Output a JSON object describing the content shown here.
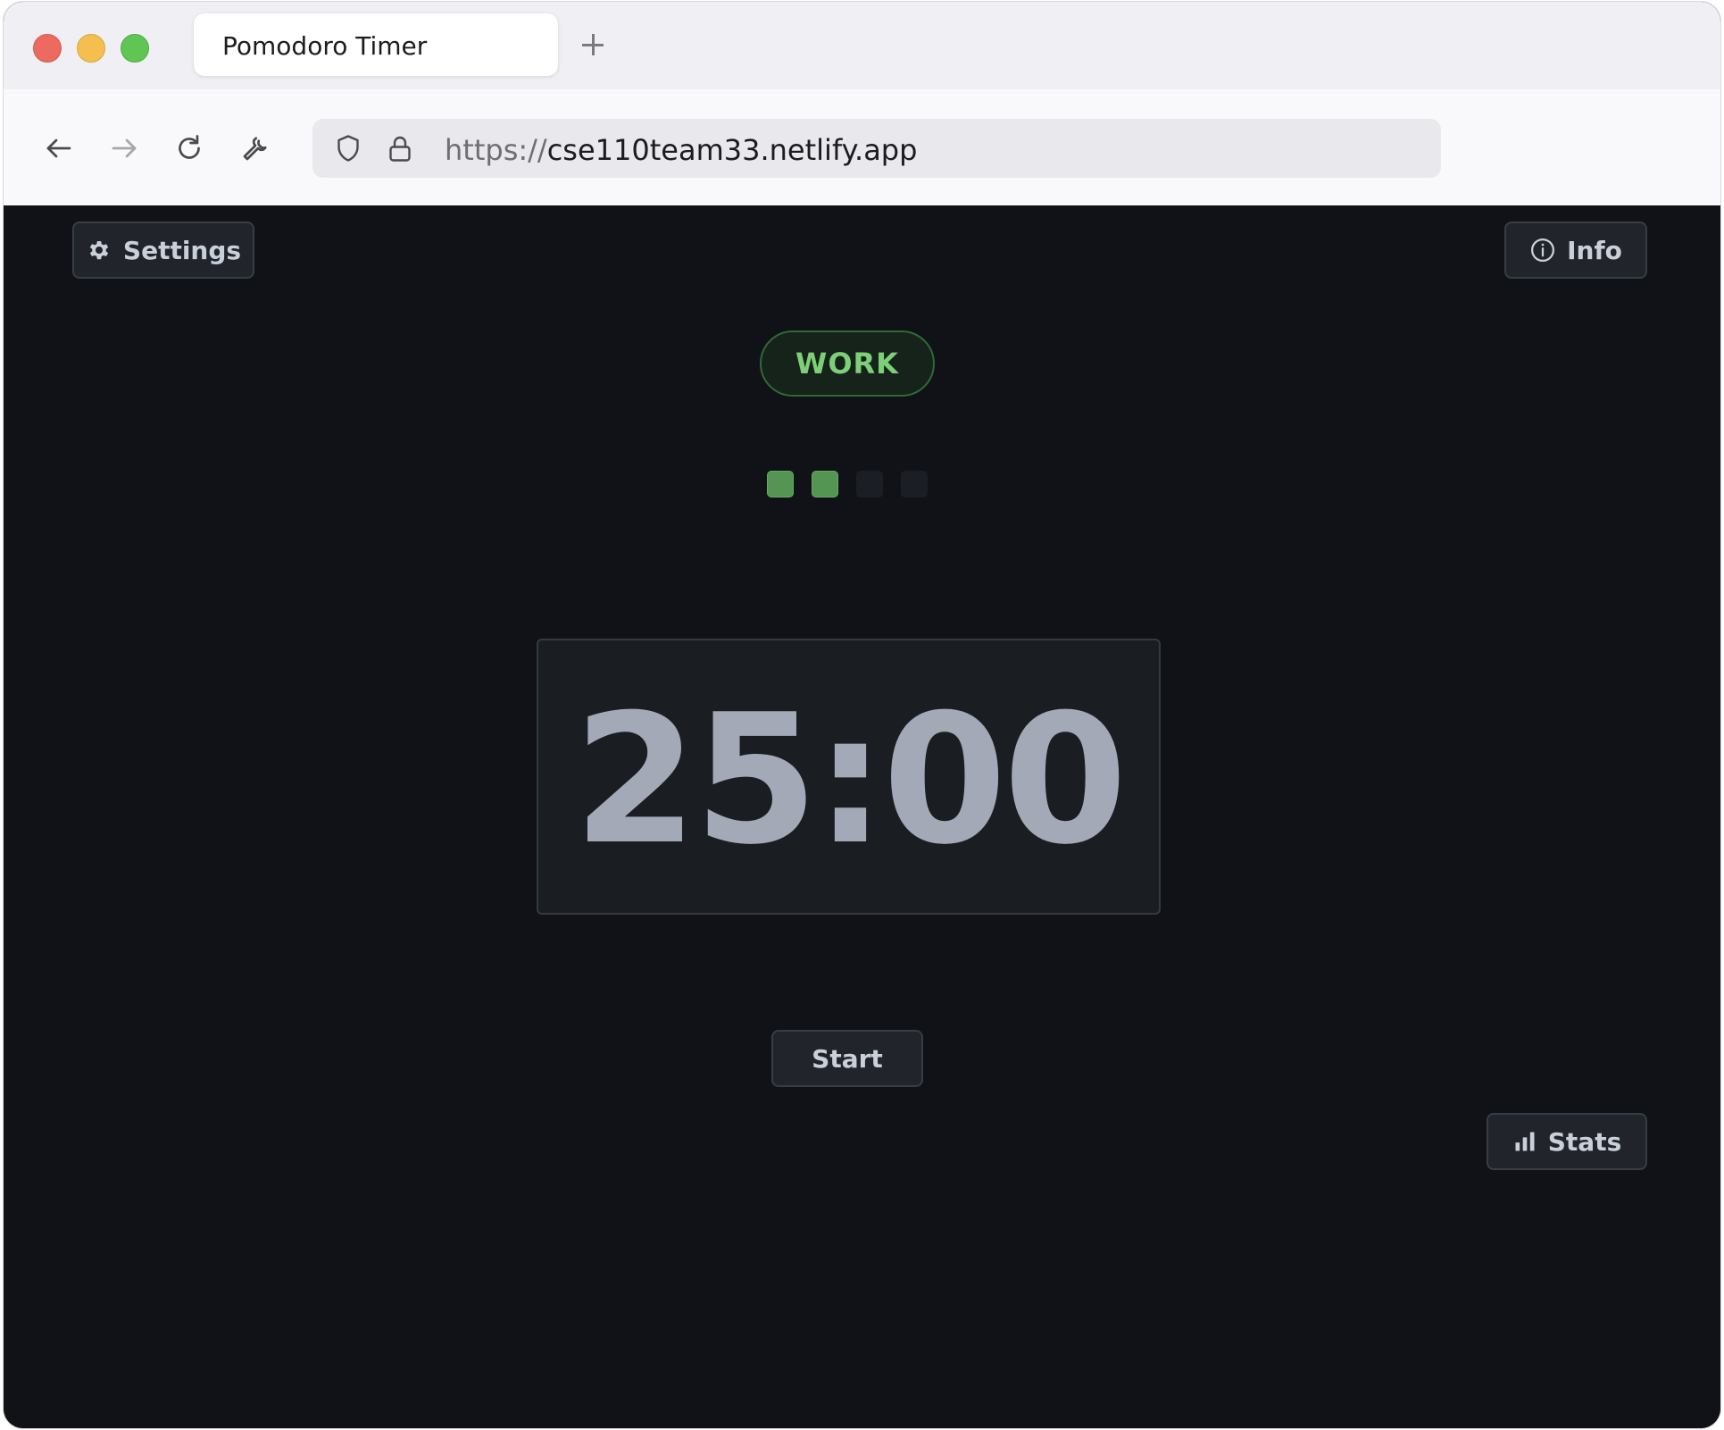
{
  "browser": {
    "tab_title": "Pomodoro Timer",
    "url_scheme": "https://",
    "url_host": "cse110team33.netlify.app"
  },
  "app": {
    "settings_label": "Settings",
    "info_label": "Info",
    "mode_label": "WORK",
    "timer_value": "25:00",
    "start_label": "Start",
    "stats_label": "Stats",
    "session_progress": {
      "completed": 2,
      "total": 4
    }
  },
  "colors": {
    "background": "#101217",
    "accent_green": "#7dd077",
    "dot_filled": "#559553",
    "timer_text": "#a3a9b6"
  },
  "icons": {
    "settings": "gear-icon",
    "info": "info-icon",
    "stats": "bar-chart-icon",
    "back": "arrow-left-icon",
    "forward": "arrow-right-icon",
    "reload": "reload-icon",
    "tools": "wrench-icon",
    "shield": "shield-icon",
    "lock": "lock-icon",
    "new_tab": "plus-icon"
  }
}
